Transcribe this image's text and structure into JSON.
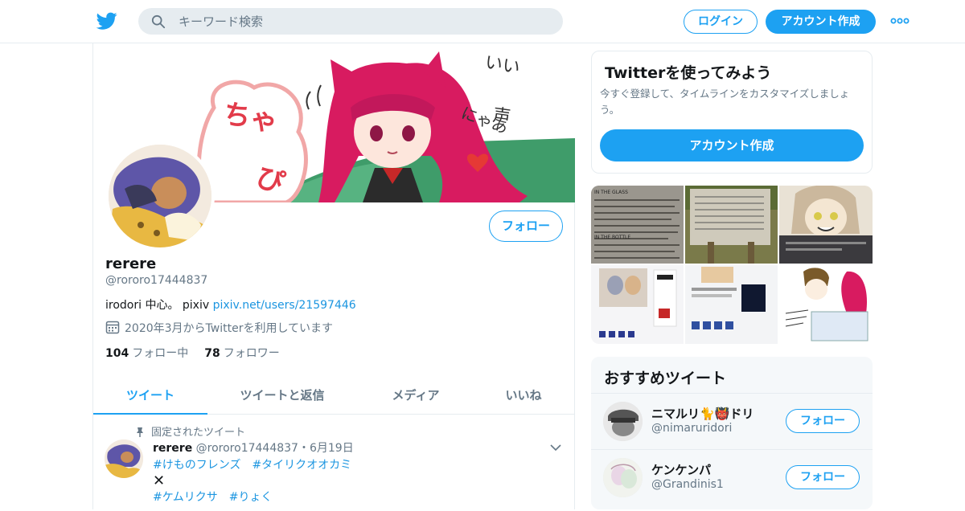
{
  "header": {
    "search_placeholder": "キーワード検索",
    "login_label": "ログイン",
    "signup_label": "アカウント作成",
    "accent": "#1da1f2"
  },
  "profile": {
    "follow_label": "フォロー",
    "name": "rerere",
    "handle": "@rororo17444837",
    "bio_text": "irodori 中心。 pixiv ",
    "bio_link": "pixiv.net/users/21597446",
    "joined": "2020年3月からTwitterを利用しています",
    "following_count": "104",
    "following_label": "フォロー中",
    "followers_count": "78",
    "followers_label": "フォロワー",
    "banner_texts": [
      "ちゃぴ",
      "いい声",
      "にゃあ"
    ]
  },
  "tabs": [
    {
      "label": "ツイート",
      "active": true
    },
    {
      "label": "ツイートと返信",
      "active": false
    },
    {
      "label": "メディア",
      "active": false
    },
    {
      "label": "いいね",
      "active": false
    }
  ],
  "pinned_tweet": {
    "pin_label": "固定されたツイート",
    "name": "rerere",
    "handle": "@rororo17444837",
    "separator": "・",
    "date": "6月19日",
    "tags_line1": "#けものフレンズ　#タイリクオオカミ",
    "mark": "✕",
    "tags_line2": "#ケムリクサ　#りょく"
  },
  "signup_card": {
    "title": "Twitterを使ってみよう",
    "description": "今すぐ登録して、タイムラインをカスタマイズしましょう。",
    "button_label": "アカウント作成"
  },
  "media_labels": [
    "IN THE GLASS",
    "IN THE BOTTLE"
  ],
  "recommend": {
    "title": "おすすめツイート",
    "items": [
      {
        "name": "ニマルリ🐈👹ドリ",
        "handle": "@nimaruridori",
        "follow_label": "フォロー"
      },
      {
        "name": "ケンケンパ",
        "handle": "@Grandinis1",
        "follow_label": "フォロー"
      }
    ]
  }
}
